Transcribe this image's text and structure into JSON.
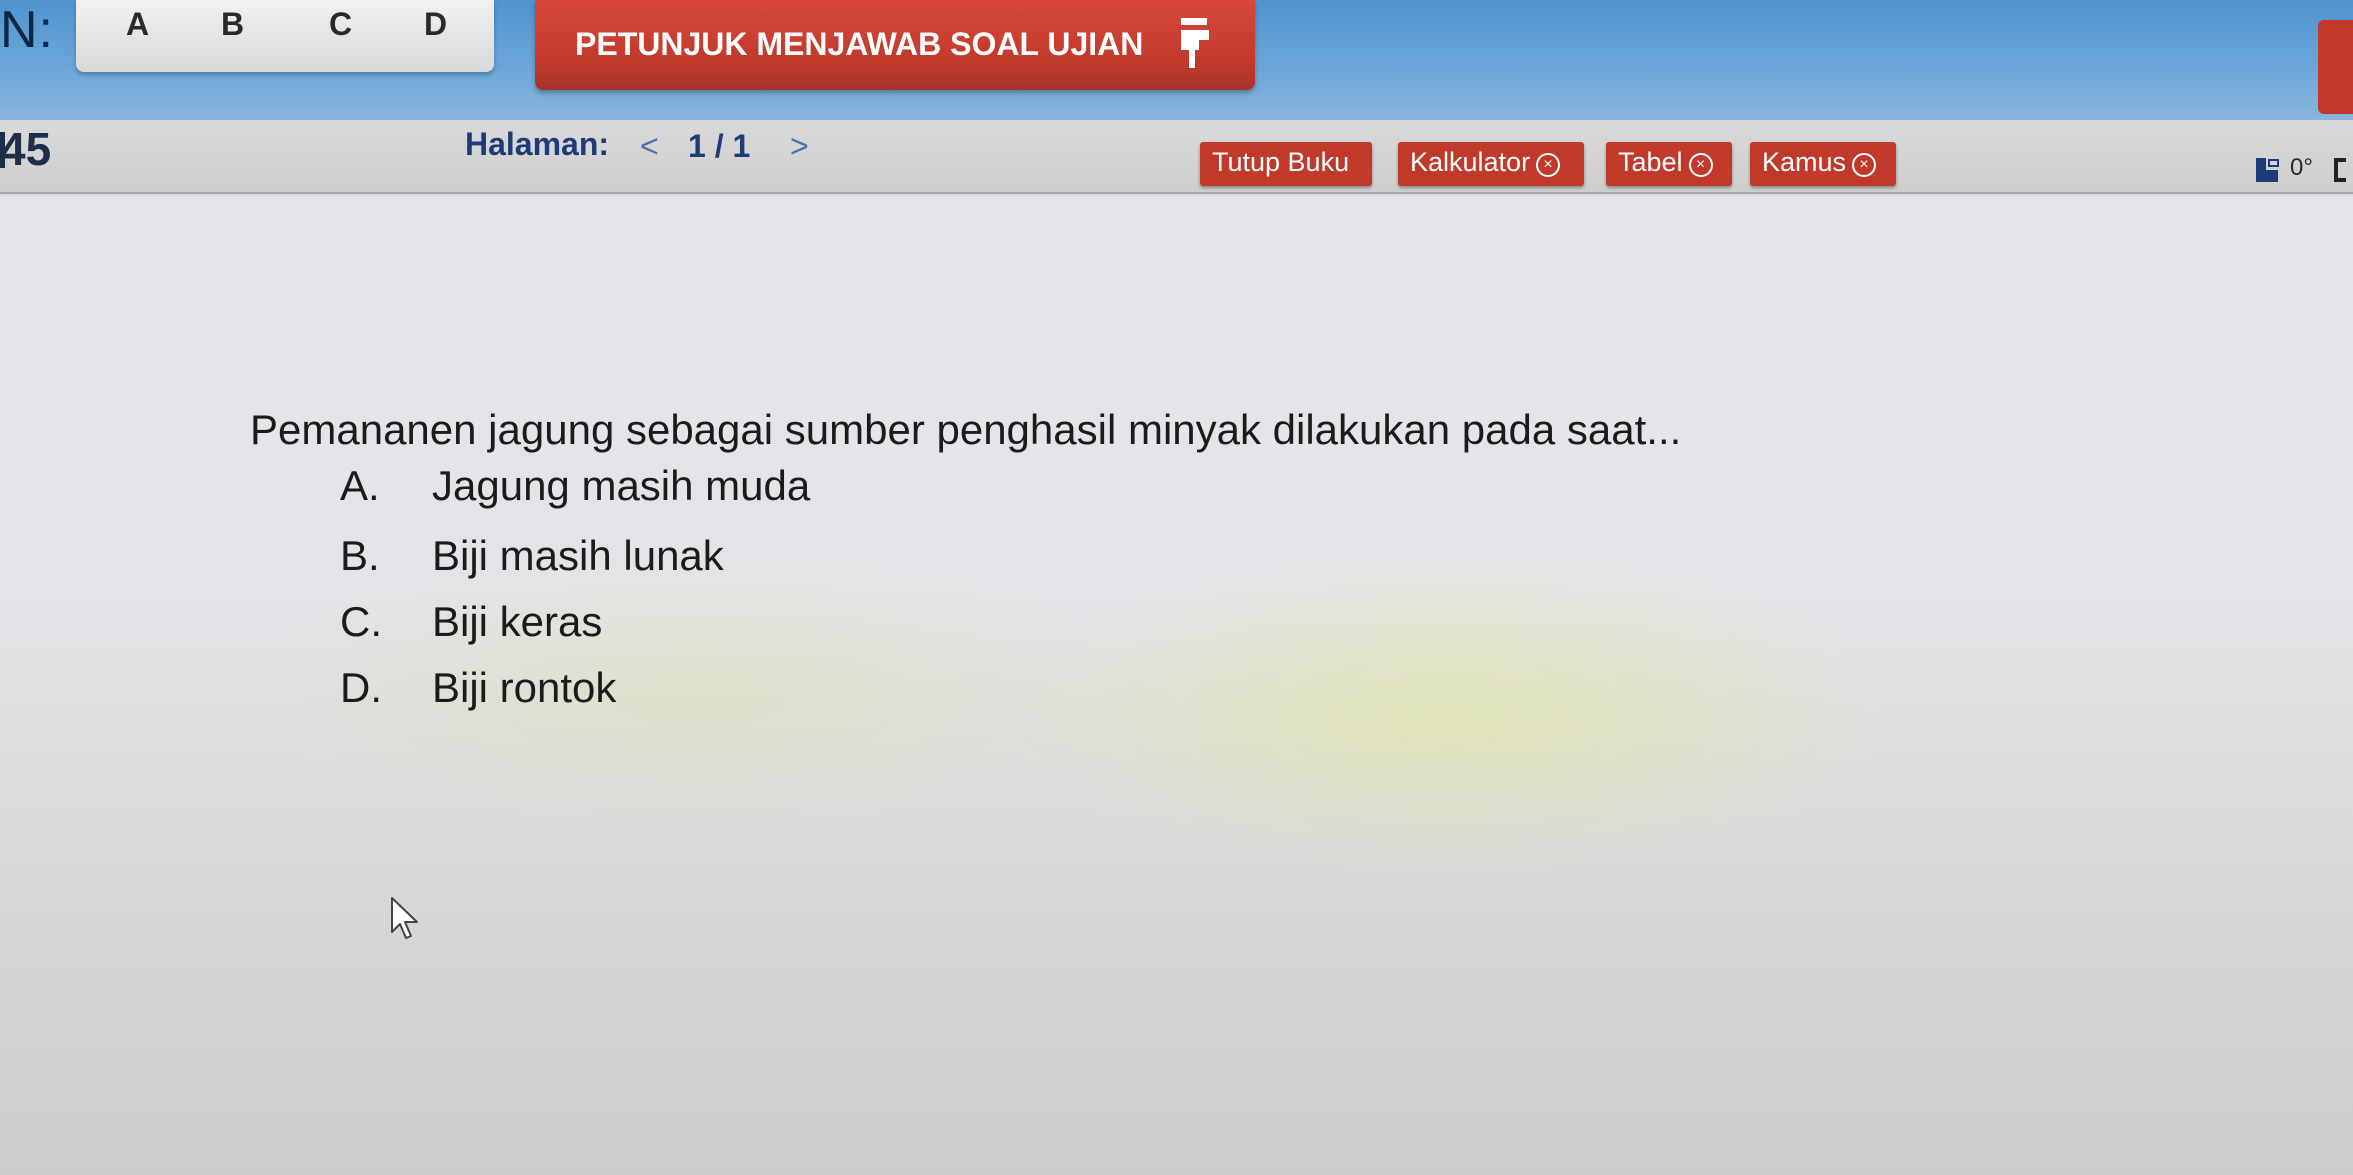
{
  "header": {
    "label_n": "N:",
    "answer_letters": [
      "A",
      "B",
      "C",
      "D"
    ],
    "petunjuk_label": "PETUNJUK MENJAWAB SOAL UJIAN",
    "petunjuk_icon": "finger-pointer-icon"
  },
  "subbar": {
    "question_number": "45",
    "halaman_label": "Halaman:",
    "page_indicator": "1 / 1",
    "prev_arrow": "<",
    "next_arrow": ">",
    "buttons": {
      "tutup_buku": "Tutup Buku",
      "kalkulator": "Kalkulator",
      "tabel": "Tabel",
      "kamus": "Kamus"
    },
    "close_glyph": "×",
    "zoom_text": "0°"
  },
  "question": {
    "text": "Pemananen jagung sebagai sumber penghasil minyak dilakukan pada saat...",
    "options": [
      {
        "letter": "A.",
        "text": "Jagung masih muda"
      },
      {
        "letter": "B.",
        "text": "Biji masih lunak"
      },
      {
        "letter": "C.",
        "text": "Biji keras"
      },
      {
        "letter": "D.",
        "text": "Biji rontok"
      }
    ]
  },
  "colors": {
    "topbar_blue": "#4f93cf",
    "button_red": "#c0392b",
    "page_text_blue": "#1d3b78"
  }
}
